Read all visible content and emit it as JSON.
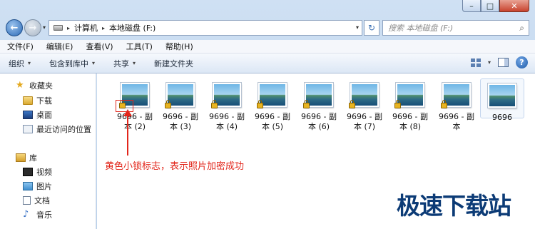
{
  "window": {
    "minimize_glyph": "–",
    "maximize_glyph": "□",
    "close_glyph": "✕"
  },
  "address": {
    "back_glyph": "←",
    "forward_glyph": "→",
    "crumbs": [
      "计算机",
      "本地磁盘 (F:)"
    ],
    "separator": "▸",
    "dropdown_glyph": "▾",
    "refresh_glyph": "↻",
    "search_placeholder": "搜索 本地磁盘 (F:)",
    "search_glyph": "⌕"
  },
  "menu": [
    "文件(F)",
    "编辑(E)",
    "查看(V)",
    "工具(T)",
    "帮助(H)"
  ],
  "toolbar": {
    "buttons": [
      {
        "label": "组织",
        "has_arrow": true
      },
      {
        "label": "包含到库中",
        "has_arrow": true
      },
      {
        "label": "共享",
        "has_arrow": true
      },
      {
        "label": "新建文件夹",
        "has_arrow": false
      }
    ],
    "arrow_glyph": "▾",
    "help_glyph": "?"
  },
  "sidebar": {
    "favorites": {
      "label": "收藏夹",
      "icon": "star-icon",
      "items": [
        {
          "label": "下载",
          "icon": "download-folder-icon"
        },
        {
          "label": "桌面",
          "icon": "desktop-icon"
        },
        {
          "label": "最近访问的位置",
          "icon": "recent-places-icon"
        }
      ]
    },
    "libraries": {
      "label": "库",
      "icon": "library-icon",
      "items": [
        {
          "label": "视频",
          "icon": "video-icon"
        },
        {
          "label": "图片",
          "icon": "pictures-icon"
        },
        {
          "label": "文档",
          "icon": "documents-icon"
        },
        {
          "label": "音乐",
          "icon": "music-icon"
        }
      ]
    }
  },
  "files": [
    {
      "line1": "9696 - 副",
      "line2": "本 (2)",
      "locked": true
    },
    {
      "line1": "9696 - 副",
      "line2": "本 (3)",
      "locked": true
    },
    {
      "line1": "9696 - 副",
      "line2": "本 (4)",
      "locked": true
    },
    {
      "line1": "9696 - 副",
      "line2": "本 (5)",
      "locked": true
    },
    {
      "line1": "9696 - 副",
      "line2": "本 (6)",
      "locked": true
    },
    {
      "line1": "9696 - 副",
      "line2": "本 (7)",
      "locked": true
    },
    {
      "line1": "9696 - 副",
      "line2": "本 (8)",
      "locked": true
    },
    {
      "line1": "9696 - 副",
      "line2": "本",
      "locked": true
    },
    {
      "line1": "9696",
      "line2": "",
      "locked": false
    }
  ],
  "annotation": {
    "text": "黄色小锁标志，表示照片加密成功",
    "color": "#e2261b"
  },
  "watermark": "极速下载站"
}
